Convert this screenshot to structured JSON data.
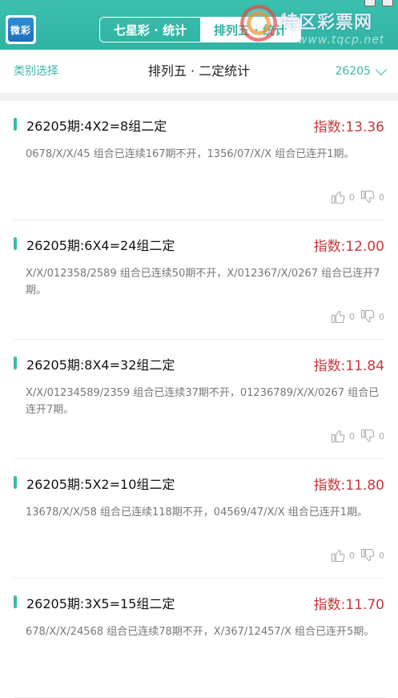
{
  "header": {
    "logo_text": "微彩",
    "tabs": [
      {
        "label": "七星彩 · 统计",
        "active": false
      },
      {
        "label": "排列五 · 统计",
        "active": true
      }
    ],
    "watermark_text": "特区彩票网",
    "watermark_url": "www.tqcp.net"
  },
  "filter": {
    "category_label": "类别选择",
    "title": "排列五 · 二定统计",
    "issue": "26205"
  },
  "colors": {
    "accent": "#30b3a3",
    "index_red": "#c8383c"
  },
  "cards": [
    {
      "title": "26205期:4X2=8组二定",
      "index": "指数:13.36",
      "desc": "0678/X/X/45 组合已连续167期不开，1356/07/X/X 组合已连开1期。",
      "likes": "0",
      "dislikes": "0"
    },
    {
      "title": "26205期:6X4=24组二定",
      "index": "指数:12.00",
      "desc": "X/X/012358/2589 组合已连续50期不开，X/012367/X/0267 组合已连开7期。",
      "likes": "0",
      "dislikes": "0"
    },
    {
      "title": "26205期:8X4=32组二定",
      "index": "指数:11.84",
      "desc": "X/X/01234589/2359 组合已连续37期不开，01236789/X/X/0267 组合已连开7期。",
      "likes": "0",
      "dislikes": "0"
    },
    {
      "title": "26205期:5X2=10组二定",
      "index": "指数:11.80",
      "desc": "13678/X/X/58 组合已连续118期不开，04569/47/X/X 组合已连开1期。",
      "likes": "0",
      "dislikes": "0"
    },
    {
      "title": "26205期:3X5=15组二定",
      "index": "指数:11.70",
      "desc": "678/X/X/24568 组合已连续78期不开，X/367/12457/X 组合已连开5期。",
      "likes": "0",
      "dislikes": "0"
    }
  ]
}
